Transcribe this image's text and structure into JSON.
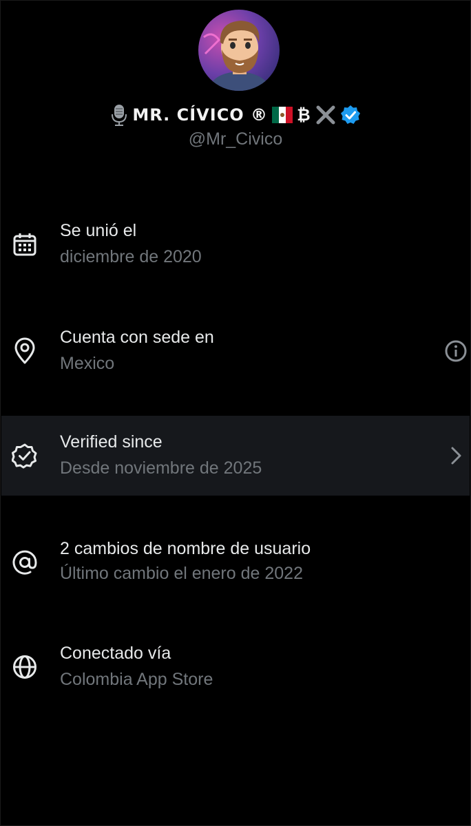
{
  "profile": {
    "display_name": "MR. CÍVICO ®",
    "display_name_suffix": "₿",
    "handle": "@Mr_Civico",
    "icons": [
      "microphone-icon",
      "mexico-flag-icon",
      "x-logo-icon",
      "verified-badge-icon"
    ],
    "verified_color": "#1d9bf0"
  },
  "rows": [
    {
      "icon": "calendar-icon",
      "title": "Se unió el",
      "subtitle": "diciembre de 2020"
    },
    {
      "icon": "location-pin-icon",
      "title": "Cuenta con sede en",
      "subtitle": "Mexico",
      "trailing": "info-icon"
    },
    {
      "icon": "verified-outline-icon",
      "title": "Verified since",
      "subtitle": "Desde noviembre de 2025",
      "trailing": "chevron-right-icon",
      "highlighted": true
    },
    {
      "icon": "at-sign-icon",
      "title": "2 cambios de nombre de usuario",
      "subtitle": "Último cambio el enero de 2022"
    },
    {
      "icon": "globe-icon",
      "title": "Conectado vía",
      "subtitle": "Colombia App Store"
    }
  ],
  "colors": {
    "background": "#000000",
    "primary_text": "#e7e9ea",
    "secondary_text": "#71767b",
    "highlight_row": "#16181c"
  }
}
